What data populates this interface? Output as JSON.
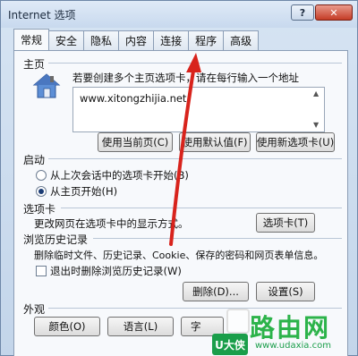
{
  "window": {
    "title": "Internet 选项",
    "help_label": "?",
    "close_label": "✕"
  },
  "tabs": [
    {
      "label": "常规",
      "active": true
    },
    {
      "label": "安全"
    },
    {
      "label": "隐私"
    },
    {
      "label": "内容"
    },
    {
      "label": "连接"
    },
    {
      "label": "程序"
    },
    {
      "label": "高级"
    }
  ],
  "homepage": {
    "group_label": "主页",
    "description": "若要创建多个主页选项卡，请在每行输入一个地址",
    "url_value": "www.xitongzhijia.net",
    "btn_current": "使用当前页(C)",
    "btn_default": "使用默认值(F)",
    "btn_new_tab": "使用新选项卡(U)"
  },
  "startup": {
    "group_label": "启动",
    "option_last_session": "从上次会话中的选项卡开始(B)",
    "option_homepage": "从主页开始(H)"
  },
  "tabs_section": {
    "group_label": "选项卡",
    "description": "更改网页在选项卡中的显示方式。",
    "btn_tabs": "选项卡(T)"
  },
  "history": {
    "group_label": "浏览历史记录",
    "description": "删除临时文件、历史记录、Cookie、保存的密码和网页表单信息。",
    "checkbox_label": "退出时删除浏览历史记录(W)",
    "btn_delete": "删除(D)...",
    "btn_settings": "设置(S)"
  },
  "appearance": {
    "group_label": "外观",
    "btn_colors": "颜色(O)",
    "btn_languages": "语言(L)",
    "btn_fonts": "字"
  },
  "watermark": {
    "badge": "U大侠",
    "big_text": "路由网",
    "url": "www.udaxia.com"
  }
}
